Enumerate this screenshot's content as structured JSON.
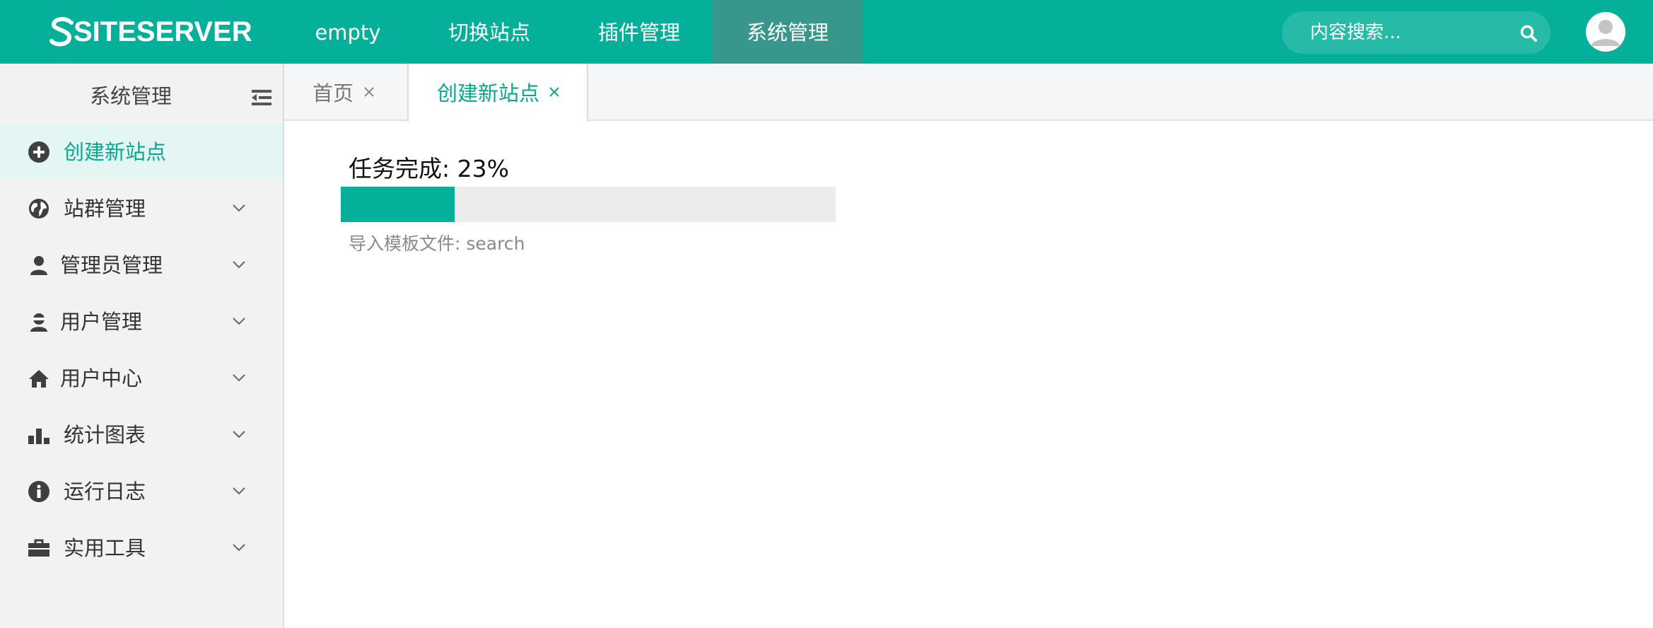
{
  "app": {
    "logo_text": "SITESERVER",
    "nav": [
      "empty",
      "切换站点",
      "插件管理",
      "系统管理"
    ],
    "active_nav_index": 3,
    "search": {
      "placeholder": "内容搜索..."
    }
  },
  "sidebar": {
    "title": "系统管理",
    "items": [
      {
        "label": "创建新站点",
        "icon": "plus-circle-icon",
        "active": true,
        "expandable": false
      },
      {
        "label": "站群管理",
        "icon": "globe-icon",
        "expandable": true
      },
      {
        "label": "管理员管理",
        "icon": "user-icon",
        "expandable": true
      },
      {
        "label": "用户管理",
        "icon": "user-secret-icon",
        "expandable": true
      },
      {
        "label": "用户中心",
        "icon": "home-icon",
        "expandable": true
      },
      {
        "label": "统计图表",
        "icon": "bar-chart-icon",
        "expandable": true
      },
      {
        "label": "运行日志",
        "icon": "info-circle-icon",
        "expandable": true
      },
      {
        "label": "实用工具",
        "icon": "briefcase-icon",
        "expandable": true
      }
    ]
  },
  "tabs": [
    {
      "label": "首页",
      "active": false
    },
    {
      "label": "创建新站点",
      "active": true
    }
  ],
  "task": {
    "title": "任务完成: 23%",
    "progress_percent": 23,
    "detail": "导入模板文件: search"
  },
  "colors": {
    "brand": "#04b09a",
    "nav_active": "#38968a",
    "sidebar_bg": "#f2f2f2",
    "active_text": "#07a891"
  }
}
